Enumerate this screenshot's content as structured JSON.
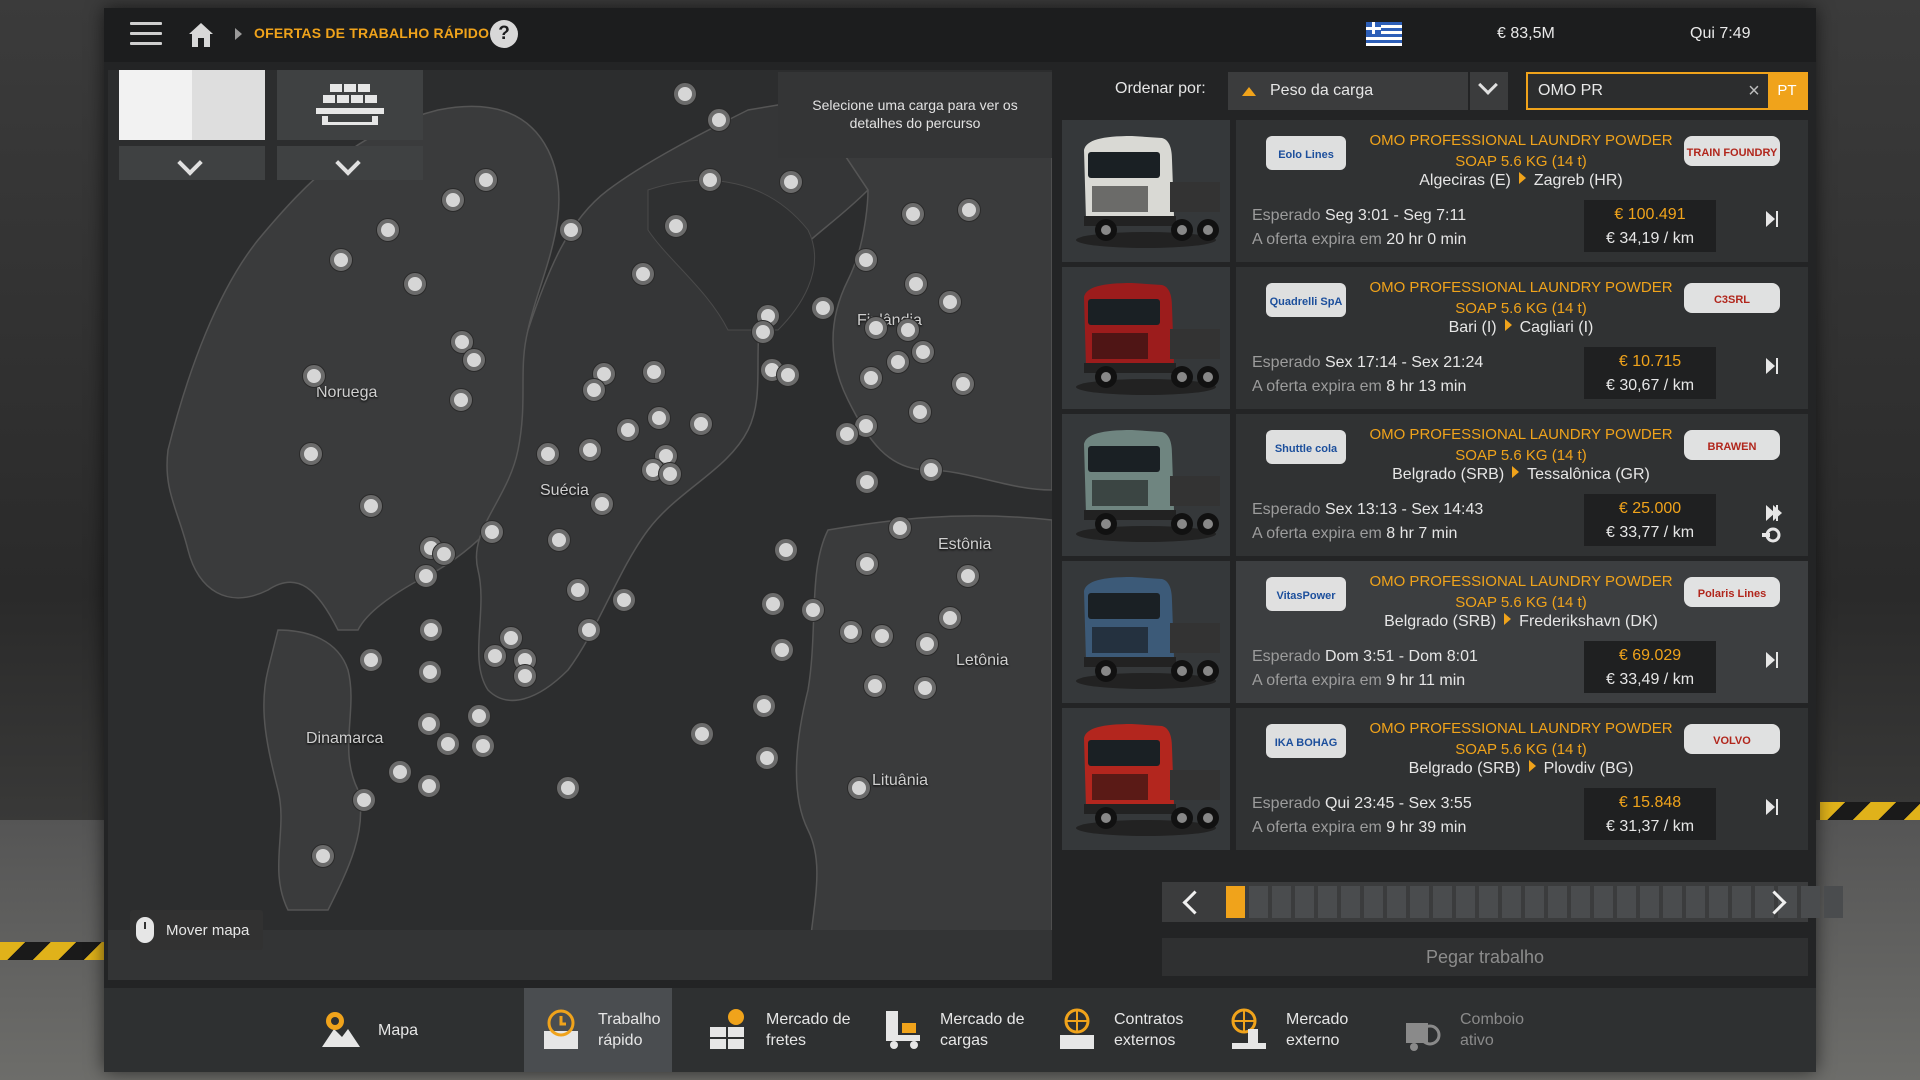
{
  "topbar": {
    "title": "OFERTAS DE TRABALHO RÁPIDO",
    "help": "?",
    "money": "€ 83,5M",
    "clock": "Qui 7:49",
    "flag_icon": "greece-flag-icon"
  },
  "map": {
    "hint": "Selecione uma carga para ver os detalhes do percurso",
    "move_map": "Mover mapa",
    "countries": [
      "Noruega",
      "Suécia",
      "Finlândia",
      "Estônia",
      "Letônia",
      "Lituânia",
      "Dinamarca"
    ]
  },
  "sort": {
    "label": "Ordenar por:",
    "value": "Peso da carga"
  },
  "search": {
    "value": "OMO PR",
    "lang": "PT"
  },
  "jobs": [
    {
      "cargo": "OMO PROFESSIONAL LAUNDRY POWDER SOAP 5.6 KG (14 t)",
      "from": "Algeciras (E)",
      "to": "Zagreb (HR)",
      "expected_label": "Esperado",
      "expected": "Seg 3:01 - Seg 7:11",
      "expires_label": "A oferta expira em",
      "expires": "20 hr 0 min",
      "pay": "€ 100.491",
      "per_km": "€ 34,19 / km",
      "logo_left": "Eolo Lines",
      "logo_right": "TRAIN FOUNDRY",
      "truck_color": "#d9d9d4"
    },
    {
      "cargo": "OMO PROFESSIONAL LAUNDRY POWDER SOAP 5.6 KG (14 t)",
      "from": "Bari (I)",
      "to": "Cagliari (I)",
      "expected_label": "Esperado",
      "expected": "Sex 17:14 - Sex 21:24",
      "expires_label": "A oferta expira em",
      "expires": "8 hr 13 min",
      "pay": "€ 10.715",
      "per_km": "€ 30,67 / km",
      "logo_left": "Quadrelli SpA",
      "logo_right": "C3SRL",
      "truck_color": "#9c1c1c"
    },
    {
      "cargo": "OMO PROFESSIONAL LAUNDRY POWDER SOAP 5.6 KG (14 t)",
      "from": "Belgrado (SRB)",
      "to": "Tessalônica (GR)",
      "expected_label": "Esperado",
      "expected": "Sex 13:13 - Sex 14:43",
      "expires_label": "A oferta expira em",
      "expires": "8 hr 7 min",
      "pay": "€ 25.000",
      "per_km": "€ 33,77 / km",
      "logo_left": "Shuttle cola",
      "logo_right": "BRAWEN",
      "truck_color": "#6f8580"
    },
    {
      "cargo": "OMO PROFESSIONAL LAUNDRY POWDER SOAP 5.6 KG (14 t)",
      "from": "Belgrado (SRB)",
      "to": "Frederikshavn (DK)",
      "expected_label": "Esperado",
      "expected": "Dom 3:51 - Dom 8:01",
      "expires_label": "A oferta expira em",
      "expires": "9 hr 11 min",
      "pay": "€ 69.029",
      "per_km": "€ 33,49 / km",
      "logo_left": "VitasPower",
      "logo_right": "Polaris Lines",
      "truck_color": "#3c5a78"
    },
    {
      "cargo": "OMO PROFESSIONAL LAUNDRY POWDER SOAP 5.6 KG (14 t)",
      "from": "Belgrado (SRB)",
      "to": "Plovdiv (BG)",
      "expected_label": "Esperado",
      "expected": "Qui 23:45 - Sex 3:55",
      "expires_label": "A oferta expira em",
      "expires": "9 hr 39 min",
      "pay": "€ 15.848",
      "per_km": "€ 31,37 / km",
      "logo_left": "IKA BOHAG",
      "logo_right": "VOLVO",
      "truck_color": "#b3261e"
    }
  ],
  "pager": {
    "pages": 27,
    "current": 1
  },
  "take_job": "Pegar trabalho",
  "nav": [
    {
      "line1": "Mapa",
      "line2": "",
      "icon": "map-pin-icon"
    },
    {
      "line1": "Trabalho",
      "line2": "rápido",
      "icon": "clock-box-icon"
    },
    {
      "line1": "Mercado de",
      "line2": "fretes",
      "icon": "freight-market-icon"
    },
    {
      "line1": "Mercado de",
      "line2": "cargas",
      "icon": "cargo-market-icon"
    },
    {
      "line1": "Contratos",
      "line2": "externos",
      "icon": "globe-contract-icon"
    },
    {
      "line1": "Mercado",
      "line2": "externo",
      "icon": "globe-market-icon"
    },
    {
      "line1": "Comboio",
      "line2": "ativo",
      "icon": "convoy-icon"
    }
  ],
  "colors": {
    "accent": "#f0a31b",
    "panel": "#303233",
    "background": "#232425"
  }
}
